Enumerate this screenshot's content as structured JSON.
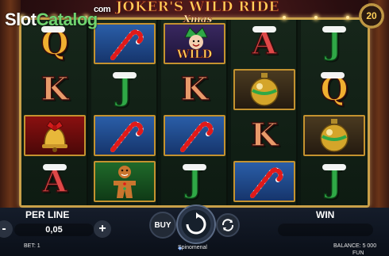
{
  "watermark": {
    "text_slot": "Slot",
    "text_catalog": "Catalog",
    "text_com": "com"
  },
  "logo": {
    "title": "JOKER'S WILD RIDE",
    "subtitle": "Xmas"
  },
  "lines_badge": "20",
  "reels": [
    [
      "Q",
      "K",
      "bell",
      "A"
    ],
    [
      "candy-cane",
      "J",
      "candy-cane",
      "gingerbread"
    ],
    [
      "wild",
      "K",
      "candy-cane",
      "J"
    ],
    [
      "A",
      "ornament",
      "K",
      "candy-cane"
    ],
    [
      "J",
      "Q",
      "ornament",
      "J"
    ]
  ],
  "wild_label": "WILD",
  "hud": {
    "per_line_label": "PER LINE",
    "stake_value": "0,05",
    "minus_label": "-",
    "plus_label": "+",
    "buy_label": "BUY",
    "win_label": "WIN",
    "bet_text": "BET: 1",
    "balance_text": "BALANCE: 5 000",
    "mode_text": "FUN",
    "provider": "Spinomenal"
  },
  "colors": {
    "frame_gold": "#c9a049",
    "logo_gold": "#ffd15a",
    "watermark_green": "#6fd36f"
  }
}
